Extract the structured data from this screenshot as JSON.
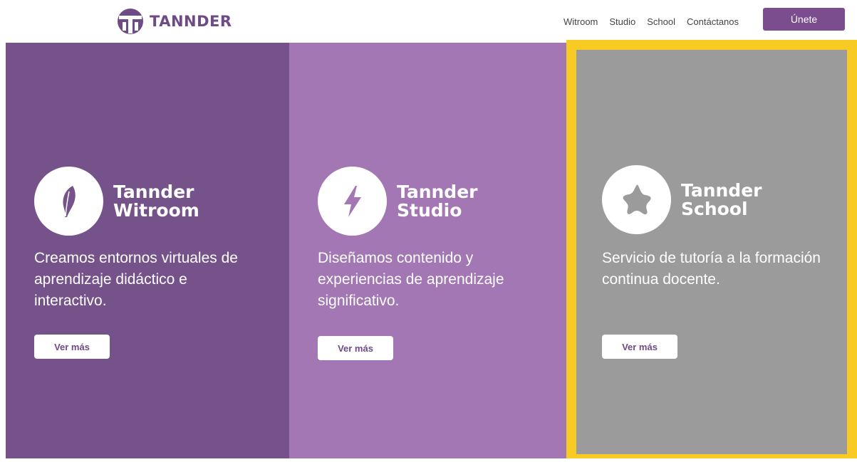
{
  "header": {
    "brand": "TANNDER",
    "nav": [
      "Witroom",
      "Studio",
      "School",
      "Contáctanos"
    ],
    "join_label": "Únete"
  },
  "panels": {
    "witroom": {
      "name_line1": "Tannder",
      "name_line2": "Witroom",
      "description": "Creamos entornos virtuales de aprendizaje didáctico e interactivo.",
      "button": "Ver más",
      "icon": "feather-icon",
      "color": "#76528a"
    },
    "studio": {
      "name_line1": "Tannder",
      "name_line2": "Studio",
      "description": "Diseñamos contenido y experiencias de aprendizaje significativo.",
      "button": "Ver más",
      "icon": "lightning-icon",
      "color": "#a277b3"
    },
    "school": {
      "name_line1": "Tannder",
      "name_line2": "School",
      "description": "Servicio de tutoría a la formación continua docente.",
      "button": "Ver más",
      "icon": "star-icon",
      "color": "#9b9b9b",
      "highlight_color": "#f7cb24"
    }
  },
  "colors": {
    "brand": "#6e4a86",
    "join_button": "#7b4c8e"
  }
}
